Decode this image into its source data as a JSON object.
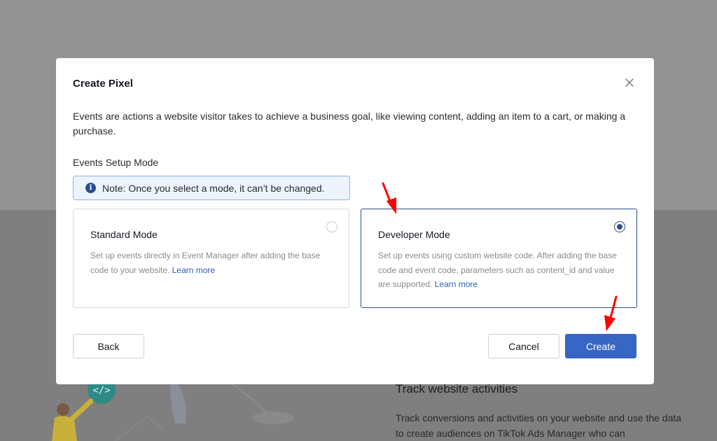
{
  "background": {
    "heading": "Track website activities",
    "text": "Track conversions and activities on your website and use the data to create audiences on TikTok Ads Manager who can"
  },
  "modal": {
    "title": "Create Pixel",
    "close_icon": "close-icon",
    "description": "Events are actions a website visitor takes to achieve a business goal, like viewing content, adding an item to a cart, or making a purchase.",
    "section_label": "Events Setup Mode",
    "note": {
      "icon": "info-icon",
      "text": "Note: Once you select a mode, it can’t be changed."
    },
    "modes": {
      "standard": {
        "title": "Standard Mode",
        "description": "Set up events directly in Event Manager after adding the base code to your website.",
        "learn_more": "Learn more",
        "selected": false
      },
      "developer": {
        "title": "Developer Mode",
        "description": "Set up events using custom website code. After adding the base code and event code, parameters such as content_id and value are supported.",
        "learn_more": "Learn more",
        "selected": true
      }
    },
    "buttons": {
      "back": "Back",
      "cancel": "Cancel",
      "create": "Create"
    }
  },
  "colors": {
    "accent": "#2b4e91",
    "primary_button": "#3866c4",
    "annotation_arrow": "#ff0000",
    "link": "#2b5fb5"
  }
}
